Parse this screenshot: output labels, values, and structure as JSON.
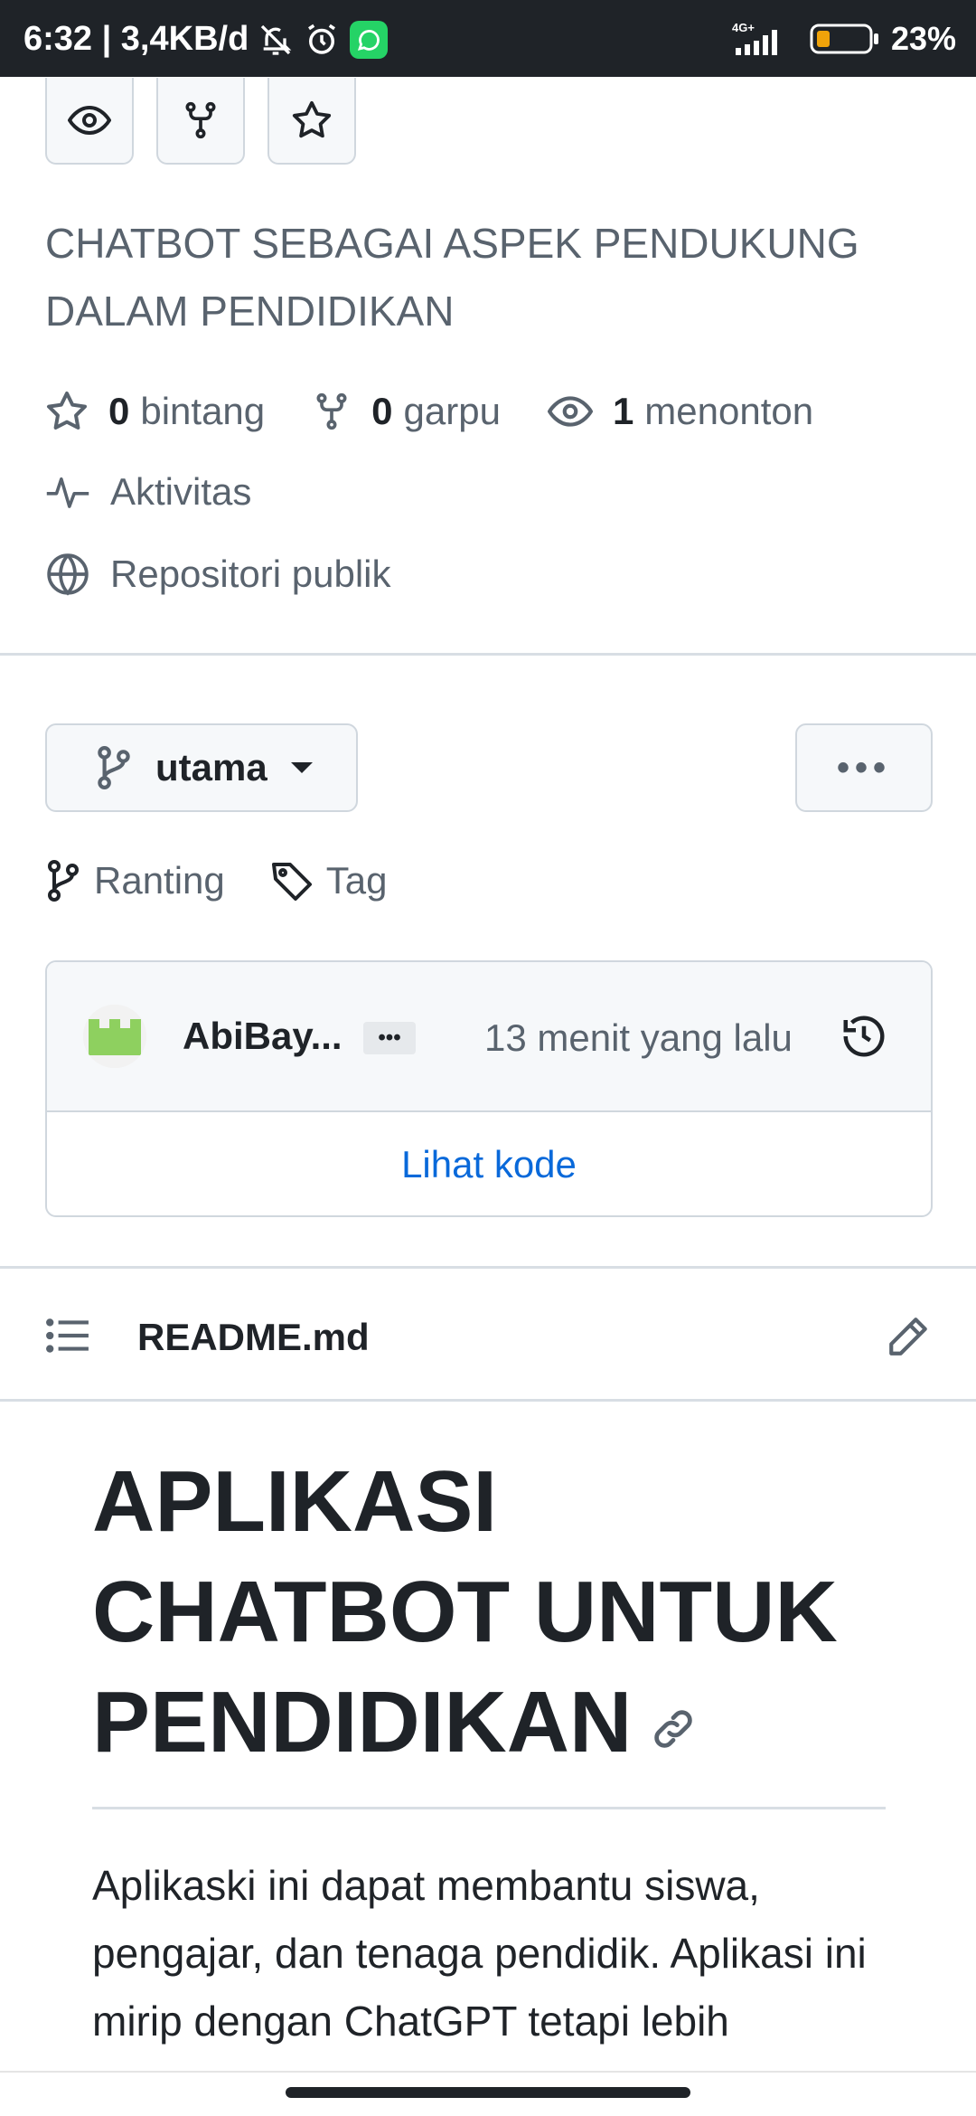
{
  "status_bar": {
    "time_speed": "6:32 | 3,4KB/d",
    "network": "4G+",
    "battery": "23%"
  },
  "repo": {
    "description": "CHATBOT SEBAGAI ASPEK PENDUKUNG DALAM PENDIDIKAN",
    "stars_count": "0",
    "stars_label": "bintang",
    "forks_count": "0",
    "forks_label": "garpu",
    "watchers_count": "1",
    "watchers_label": "menonton",
    "activity_label": "Aktivitas",
    "visibility_label": "Repositori publik"
  },
  "branch": {
    "current": "utama",
    "more_label": "•••",
    "branches_label": "Ranting",
    "tags_label": "Tag"
  },
  "commit": {
    "author": "AbiBay...",
    "ellipsis": "•••",
    "time": "13 menit yang lalu",
    "view_code": "Lihat kode"
  },
  "readme": {
    "filename": "README.md",
    "title": "APLIKASI CHATBOT UNTUK PENDIDIKAN",
    "body": "Aplikaski ini dapat membantu siswa, pengajar, dan tenaga pendidik. Aplikasi ini mirip dengan ChatGPT tetapi lebih"
  }
}
